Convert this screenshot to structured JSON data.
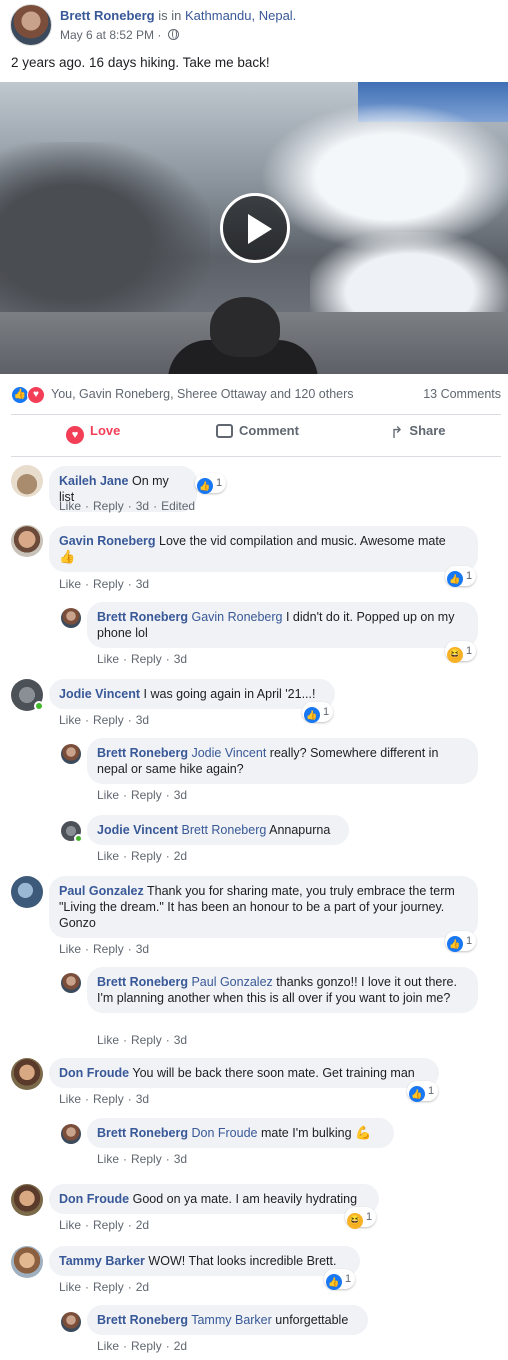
{
  "post": {
    "author": "Brett Roneberg",
    "verb": "is in",
    "location": "Kathmandu, Nepal.",
    "timestamp": "May 6 at 8:52 PM",
    "separator": "·",
    "text": "2 years ago. 16 days hiking. Take me back!"
  },
  "reactions": {
    "summary": "You, Gavin Roneberg, Sheree Ottaway and 120 others",
    "comments_count": "13 Comments",
    "like_glyph": "👍",
    "love_glyph": "♥"
  },
  "actions": {
    "love": "Love",
    "comment": "Comment",
    "share": "Share",
    "love_glyph": "♥",
    "share_glyph": "↱"
  },
  "comment_labels": {
    "like": "Like",
    "reply": "Reply",
    "dot": "·",
    "edited": "Edited"
  },
  "comments": [
    {
      "name": "Kaileh Jane",
      "text": "On my list",
      "time": "3d",
      "reactions": "1"
    },
    {
      "name": "Gavin Roneberg",
      "text": "Love the vid compilation and music. Awesome mate",
      "emoji": "👍",
      "time": "3d",
      "reactions": "1"
    },
    {
      "name": "Brett Roneberg",
      "tag": "Gavin Roneberg",
      "text": "I didn't do it. Popped up on my phone lol",
      "time": "3d",
      "reactions": "1"
    },
    {
      "name": "Jodie Vincent",
      "text": "I was going again in April '21...!",
      "time": "3d",
      "reactions": "1"
    },
    {
      "name": "Brett Roneberg",
      "tag": "Jodie Vincent",
      "text": "really? Somewhere different in nepal or same hike again?",
      "time": "3d"
    },
    {
      "name": "Jodie Vincent",
      "tag": "Brett Roneberg",
      "text": "Annapurna",
      "time": "2d"
    },
    {
      "name": "Paul Gonzalez",
      "text": "Thank you for sharing mate, you truly embrace the term \"Living the dream.\" It has been an honour to be a part of your journey. Gonzo",
      "time": "3d",
      "reactions": "1"
    },
    {
      "name": "Brett Roneberg",
      "tag": "Paul Gonzalez",
      "text": "thanks gonzo!! I love it out there. I'm planning another when this is all over if you want to join me?",
      "time": "3d"
    },
    {
      "name": "Don Froude",
      "text": "You will be back there soon mate. Get training man",
      "time": "3d",
      "reactions": "1"
    },
    {
      "name": "Brett Roneberg",
      "tag": "Don Froude",
      "text": "mate I'm bulking",
      "emoji": "💪",
      "time": "3d"
    },
    {
      "name": "Don Froude",
      "text": "Good on ya mate. I am heavily hydrating",
      "time": "2d",
      "reactions": "1"
    },
    {
      "name": "Tammy Barker",
      "text": "WOW! That looks incredible Brett.",
      "time": "2d",
      "reactions": "1"
    },
    {
      "name": "Brett Roneberg",
      "tag": "Tammy Barker",
      "text": "unforgettable",
      "time": "2d"
    }
  ],
  "colors": {
    "link": "#385898",
    "muted": "#606770",
    "bubble": "#f0f2f5",
    "like_blue": "#1877f2",
    "love_red": "#f33e58",
    "online_green": "#42b72a"
  },
  "icons": {
    "like": "like-icon",
    "love": "love-icon",
    "haha": "haha-icon",
    "play": "play-icon",
    "globe": "globe-icon",
    "comment": "comment-icon",
    "share": "share-icon"
  }
}
